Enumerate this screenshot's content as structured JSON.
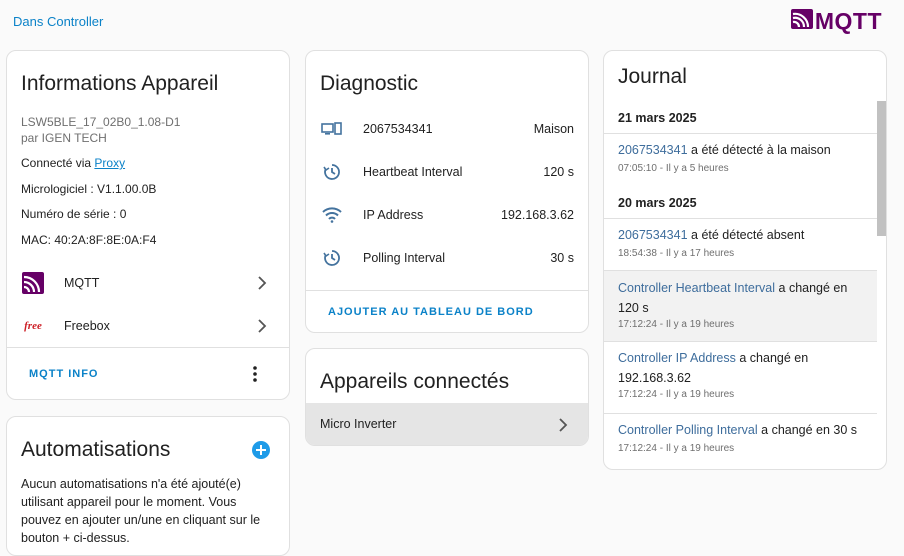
{
  "breadcrumb": "Dans Controller",
  "logo": {
    "text": "MQTT",
    "icon": "mqtt-logo-icon",
    "color": "#660066"
  },
  "accent_color": "#0b82c8",
  "device_info": {
    "title": "Informations Appareil",
    "model": "LSW5BLE_17_02B0_1.08-D1",
    "manufacturer": "par IGEN TECH",
    "connected_via_label": "Connecté via",
    "connected_via_link": "Proxy",
    "firmware": "Micrologiciel : V1.1.00.0B",
    "serial": "Numéro de série : 0",
    "mac": "MAC: 40:2A:8F:8E:0A:F4",
    "integrations": [
      {
        "label": "MQTT",
        "icon": "mqtt-icon"
      },
      {
        "label": "Freebox",
        "icon": "freebox-icon",
        "icon_text": "free"
      }
    ],
    "action": "MQTT INFO"
  },
  "automations": {
    "title": "Automatisations",
    "text": "Aucun automatisations n'a été ajouté(e) utilisant appareil pour le moment. Vous pouvez en ajouter un/une en cliquant sur le bouton + ci-dessus."
  },
  "diagnostic": {
    "title": "Diagnostic",
    "rows": [
      {
        "icon": "devices-icon",
        "label": "2067534341",
        "value": "Maison"
      },
      {
        "icon": "timer-icon",
        "label": "Heartbeat Interval",
        "value": "120 s"
      },
      {
        "icon": "wifi-icon",
        "label": "IP Address",
        "value": "192.168.3.62"
      },
      {
        "icon": "timer-icon",
        "label": "Polling Interval",
        "value": "30 s"
      }
    ],
    "action": "AJOUTER AU TABLEAU DE BORD"
  },
  "connected": {
    "title": "Appareils connectés",
    "items": [
      "Micro Inverter"
    ]
  },
  "journal": {
    "title": "Journal",
    "groups": [
      {
        "date": "21 mars 2025",
        "entries": [
          {
            "link": "2067534341",
            "text": "a été détecté à la maison",
            "time": "07:05:10 - Il y a 5 heures"
          }
        ]
      },
      {
        "date": "20 mars 2025",
        "entries": [
          {
            "link": "2067534341",
            "text": "a été détecté absent",
            "time": "18:54:38 - Il y a 17 heures"
          },
          {
            "link": "Controller Heartbeat Interval",
            "text": "a changé en 120 s",
            "time": "17:12:24 - Il y a 19 heures"
          },
          {
            "link": "Controller IP Address",
            "text": "a changé en 192.168.3.62",
            "time": "17:12:24 - Il y a 19 heures"
          },
          {
            "link": "Controller Polling Interval",
            "text": "a changé en 30 s",
            "time": "17:12:24 - Il y a 19 heures"
          }
        ]
      }
    ]
  }
}
